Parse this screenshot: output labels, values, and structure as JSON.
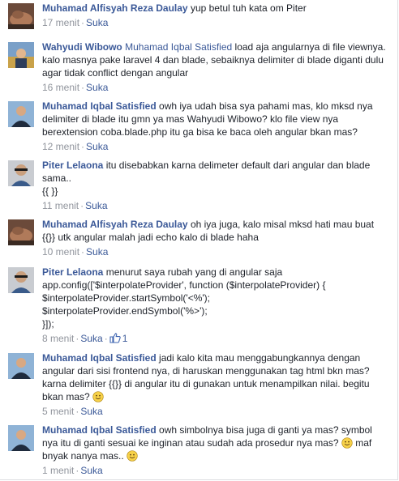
{
  "colors": {
    "link": "#3b5998",
    "meta": "#90949c",
    "text": "#1d2129"
  },
  "like_label": "Suka",
  "comments": [
    {
      "author": "Muhamad Alfisyah Reza Daulay",
      "text": "yup betul tuh kata om Piter",
      "time": "17 menit"
    },
    {
      "author": "Wahyudi Wibowo",
      "mention": "Muhamad Iqbal Satisfied",
      "text": "load aja angularnya di file viewnya. kalo masnya pake laravel 4 dan blade, sebaiknya delimiter di blade diganti dulu agar tidak conflict dengan angular",
      "time": "16 menit"
    },
    {
      "author": "Muhamad Iqbal Satisfied",
      "text": "owh iya udah bisa sya pahami mas, klo mksd nya delimiter di blade itu gmn ya mas Wahyudi Wibowo? klo file view nya berextension coba.blade.php itu ga bisa ke baca oleh angular bkan mas?",
      "time": "12 menit"
    },
    {
      "author": "Piter Lelaona",
      "text": "itu disebabkan karna delimeter default dari angular dan blade sama..",
      "text2": "{{ }}",
      "time": "11 menit"
    },
    {
      "author": "Muhamad Alfisyah Reza Daulay",
      "text": "oh iya juga, kalo misal mksd hati mau buat {{}} utk angular malah jadi echo kalo di blade haha",
      "time": "10 menit"
    },
    {
      "author": "Piter Lelaona",
      "text": "menurut saya rubah yang di angular saja",
      "code": [
        "app.config(['$interpolateProvider', function ($interpolateProvider) {",
        "$interpolateProvider.startSymbol('<%');",
        "$interpolateProvider.endSymbol('%>');",
        "}]);"
      ],
      "time": "8 menit",
      "likes": "1"
    },
    {
      "author": "Muhamad Iqbal Satisfied",
      "text": "jadi kalo kita mau menggabungkannya dengan angular dari sisi frontend nya, di haruskan menggunakan tag html bkn mas? karna delimiter {{}} di angular itu di gunakan untuk menampilkan nilai. begitu bkan mas?",
      "emoji": "smile",
      "time": "5 menit"
    },
    {
      "author": "Muhamad Iqbal Satisfied",
      "text": "owh simbolnya bisa juga di ganti ya mas? symbol nya itu di ganti sesuai ke inginan atau sudah ada prosedur nya mas?",
      "text_after_emoji": "maf bnyak nanya mas..",
      "emoji": "smile",
      "time": "1 menit"
    }
  ]
}
